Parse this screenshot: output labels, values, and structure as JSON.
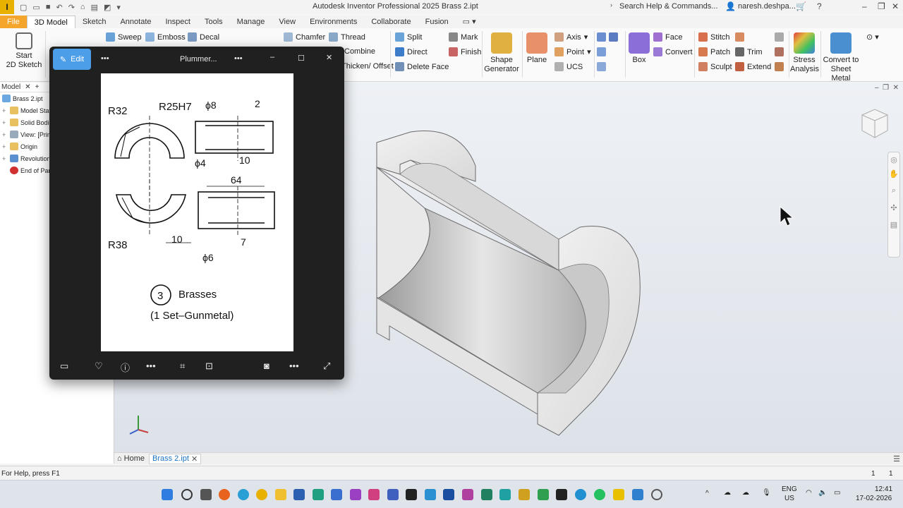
{
  "titlebar": {
    "logo": "I",
    "title": "Autodesk Inventor Professional 2025   Brass 2.ipt",
    "search": "Search Help & Commands...",
    "user": "naresh.deshpa..."
  },
  "tabs": [
    "File",
    "3D Model",
    "Sketch",
    "Annotate",
    "Inspect",
    "Tools",
    "Manage",
    "View",
    "Environments",
    "Collaborate",
    "Fusion"
  ],
  "ribbon": {
    "start_sketch": [
      "Start",
      "2D Sketch"
    ],
    "sweep": "Sweep",
    "emboss": "Emboss",
    "decal": "Decal",
    "chamfer": "Chamfer",
    "thread": "Thread",
    "combine": "Combine",
    "thicken": "Thicken/ Offset",
    "split": "Split",
    "direct": "Direct",
    "delete_face": "Delete Face",
    "mark": "Mark",
    "finish": "Finish",
    "shape_generator": [
      "Shape",
      "Generator"
    ],
    "plane": "Plane",
    "axis": "Axis",
    "point": "Point",
    "ucs": "UCS",
    "box": "Box",
    "face": "Face",
    "convert": "Convert",
    "stitch": "Stitch",
    "patch": "Patch",
    "sculpt": "Sculpt",
    "trim": "Trim",
    "extend": "Extend",
    "stress": [
      "Stress",
      "Analysis"
    ],
    "sheet_metal": [
      "Convert to",
      "Sheet Metal"
    ]
  },
  "browser": {
    "tab_label": "Model",
    "items": [
      "Brass 2.ipt",
      "Model State",
      "Solid Bodies",
      "View: [Primary]",
      "Origin",
      "Revolution",
      "End of Part"
    ]
  },
  "photos": {
    "edit_label": "Edit",
    "title": "Plummer...",
    "drawing": {
      "r32": "R32",
      "r25": "R25H7",
      "phi8": "ϕ8",
      "d2": "2",
      "phi4": "ϕ4",
      "d10a": "10",
      "d64": "64",
      "r38": "R38",
      "d10b": "10",
      "d7": "7",
      "phi6": "ϕ6",
      "num": "3",
      "label1": "Brasses",
      "label2": "(1 Set–Gunmetal)"
    }
  },
  "doctabs": {
    "home": "Home",
    "active": "Brass 2.ipt"
  },
  "status": {
    "help": "For Help, press F1",
    "n1": "1",
    "n2": "1"
  },
  "taskbar": {
    "lang1": "ENG",
    "lang2": "US",
    "time": "12:41",
    "date": "17-02-2026"
  }
}
